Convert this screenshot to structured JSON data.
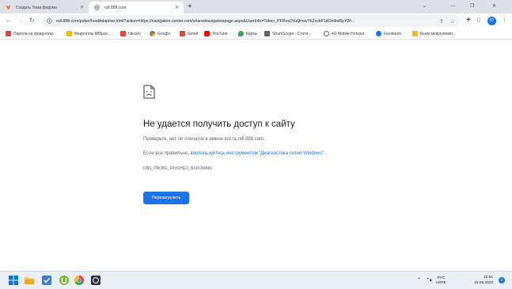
{
  "browser": {
    "tabs": [
      {
        "title": "Создать Тема форума",
        "active": false
      },
      {
        "title": "ndl.888.com",
        "active": true
      }
    ],
    "new_tab_icon": "plus-icon",
    "url": "ndl.888.com/poker/hostAdaptive.html?action=https://navigation-center.com/sharednavigationpage.aspx&UserInfo=Token_PFRva2VuQmsvYkZvckF1dGhlbnRpY2F...",
    "profile_initial": "Ю",
    "bookmarks": [
      "Пароли на фрироллы",
      "Фрироллы 888pok...",
      "hikoz/o",
      "Google",
      "Gmail",
      "YouTube",
      "Карты",
      "SharkScope - Стати...",
      "4G Mobile Hotspot",
      "Facebook",
      "Бьем микролимит..."
    ]
  },
  "page": {
    "error_title": "Не удается получить доступ к сайту",
    "check_text": "Проверьте, нет ли опечаток в имени хоста ndl.888.com.",
    "if_ok_prefix": "Если все правильно, ",
    "if_ok_link": "воспользуйтесь инструментом \"Диагностика сетей Windows\"",
    "if_ok_suffix": ".",
    "error_code": "DNS_PROBE_FINISHED_NXDOMAIN",
    "reload_label": "Перезагрузить"
  },
  "taskbar": {
    "lang_line1": "РУС",
    "lang_line2": "UKRE",
    "time": "10:51",
    "date": "15.09.2023",
    "notifications": "2"
  },
  "colors": {
    "accent": "#1a73e8",
    "tabstrip": "#dee1e6",
    "taskbar": "#e9eef7"
  }
}
